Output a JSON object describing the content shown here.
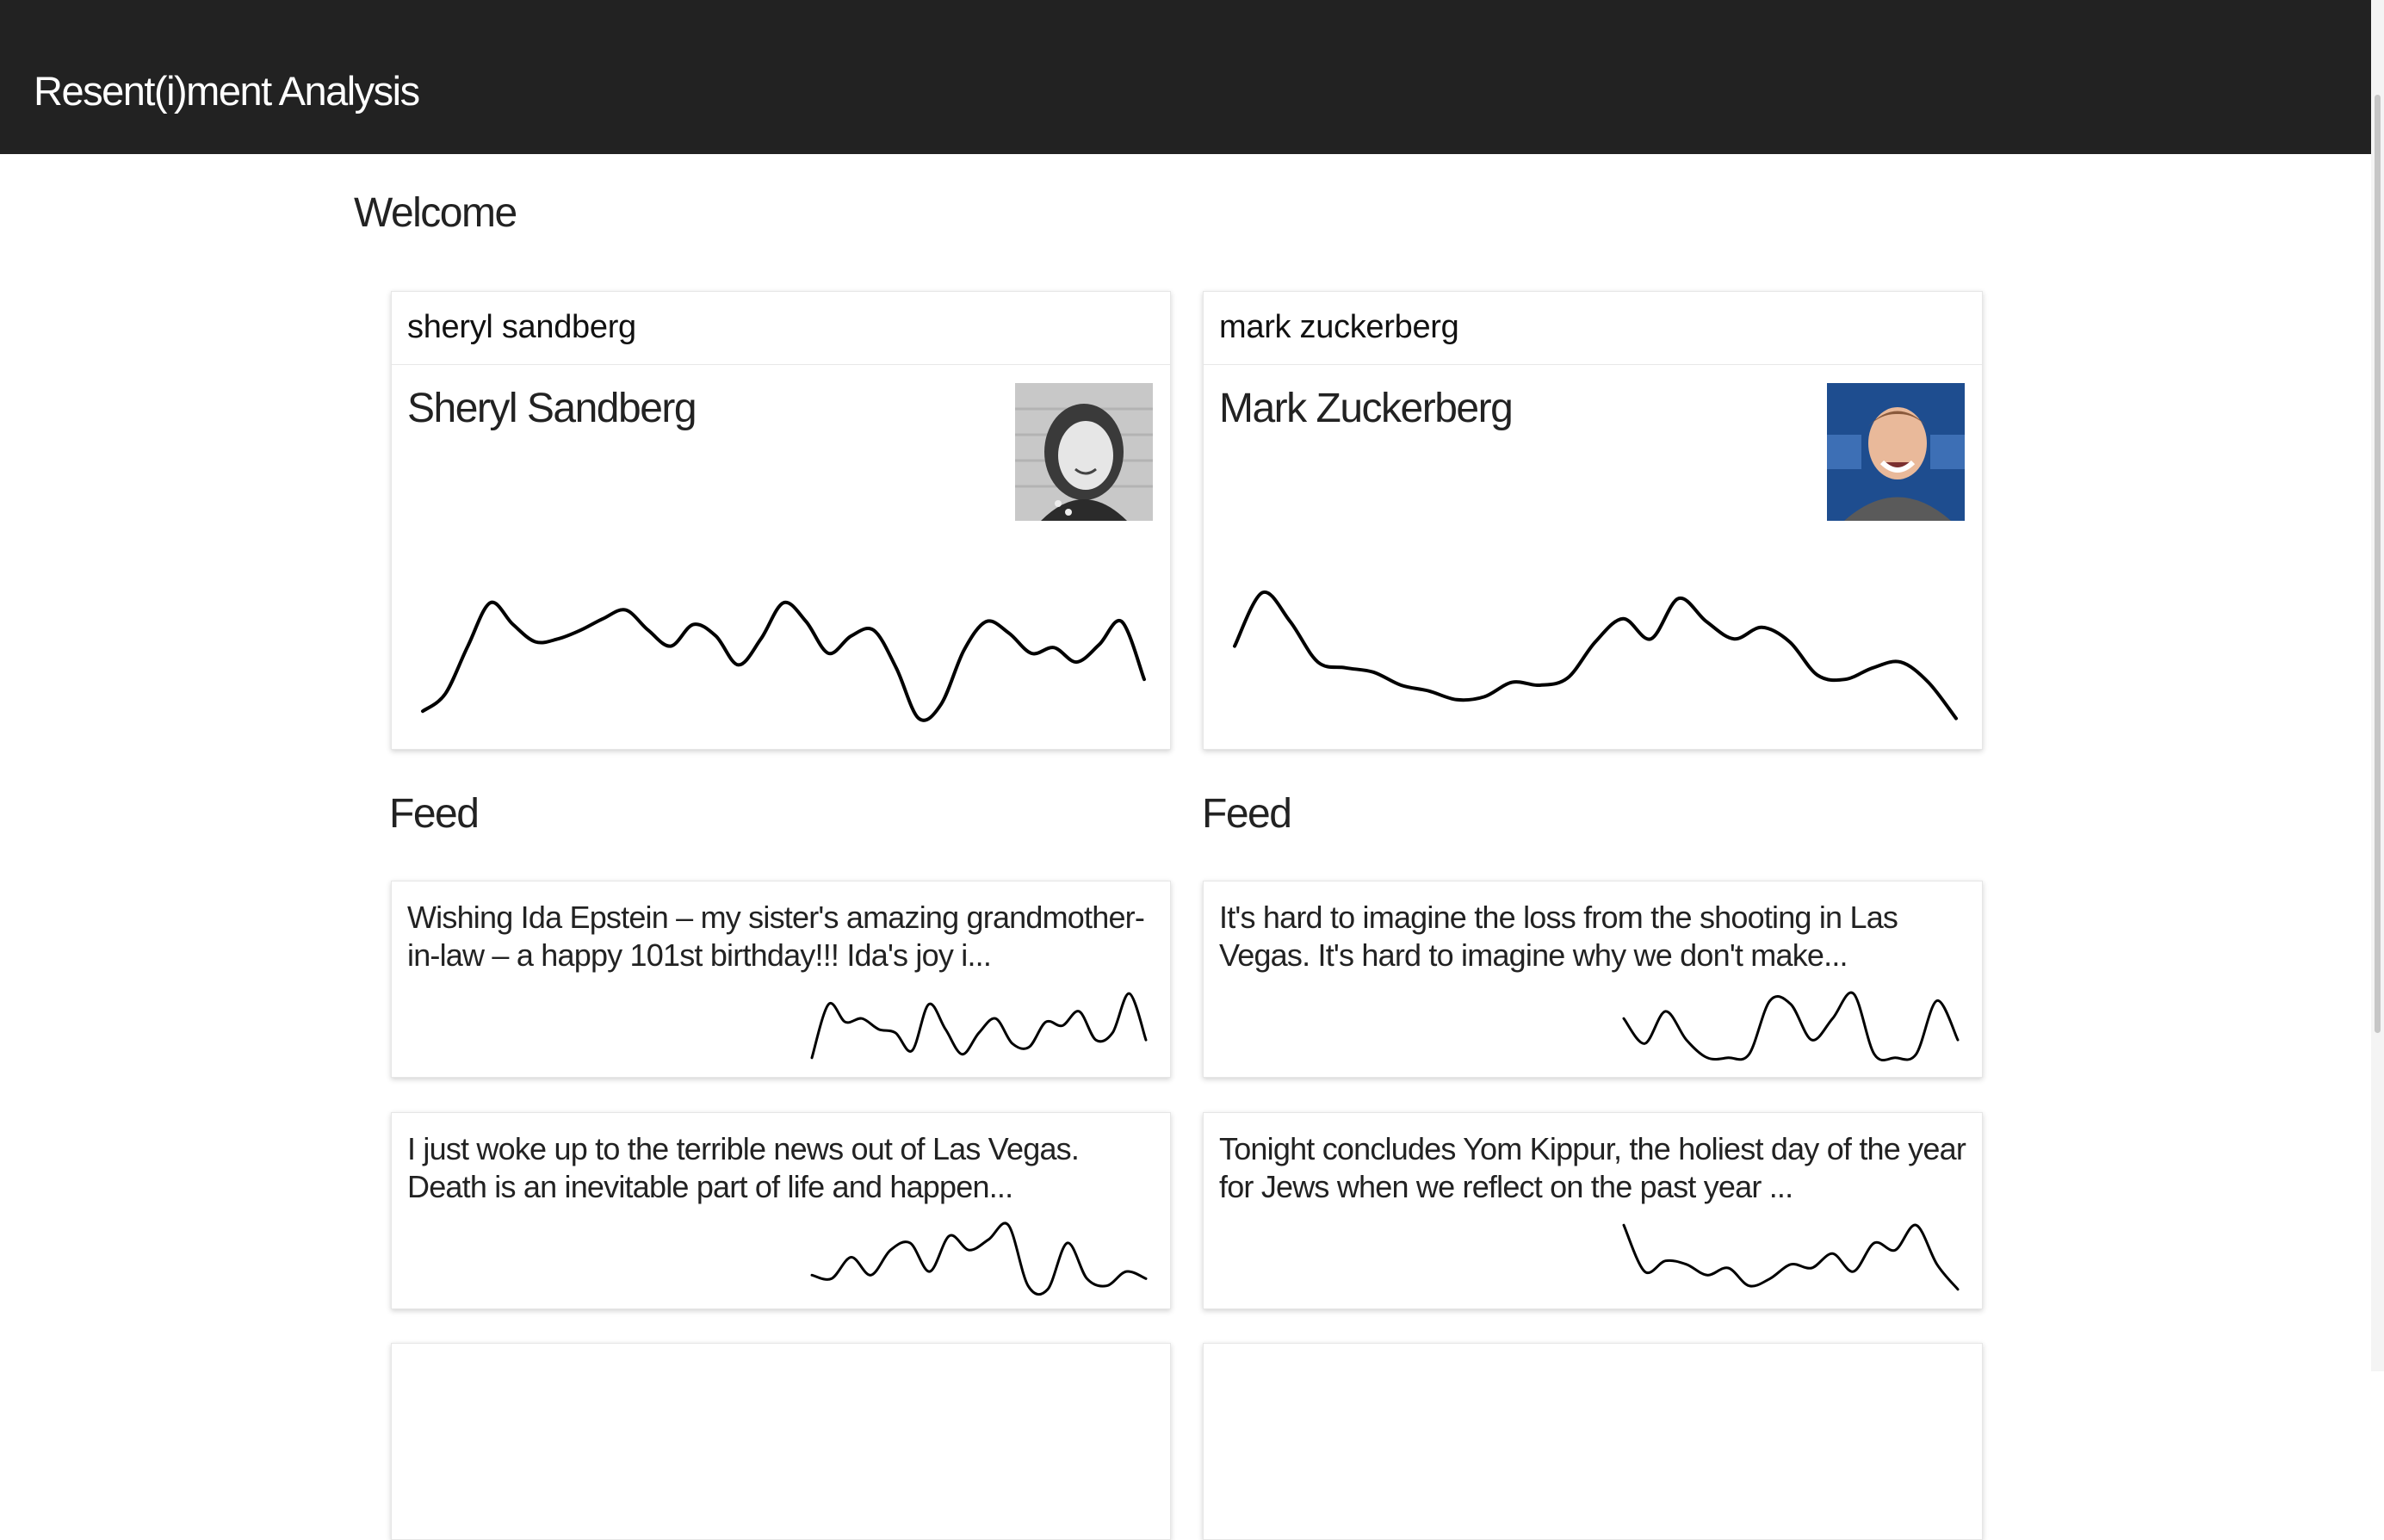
{
  "app": {
    "title": "Resent(i)ment Analysis"
  },
  "page": {
    "heading": "Welcome"
  },
  "profiles": [
    {
      "handle": "sheryl sandberg",
      "name": "Sheryl Sandberg",
      "avatar_icon": "person-photo",
      "sentiment": [
        0.1,
        0.22,
        0.55,
        0.85,
        0.7,
        0.58,
        0.6,
        0.66,
        0.74,
        0.8,
        0.66,
        0.55,
        0.7,
        0.62,
        0.42,
        0.6,
        0.85,
        0.72,
        0.5,
        0.62,
        0.66,
        0.4,
        0.05,
        0.15,
        0.52,
        0.72,
        0.64,
        0.5,
        0.54,
        0.44,
        0.56,
        0.72,
        0.32
      ]
    },
    {
      "handle": "mark zuckerberg",
      "name": "Mark Zuckerberg",
      "avatar_icon": "person-photo",
      "sentiment": [
        0.55,
        0.92,
        0.72,
        0.44,
        0.4,
        0.37,
        0.28,
        0.24,
        0.18,
        0.2,
        0.3,
        0.28,
        0.33,
        0.58,
        0.74,
        0.6,
        0.88,
        0.72,
        0.6,
        0.68,
        0.58,
        0.35,
        0.32,
        0.4,
        0.44,
        0.3,
        0.05
      ]
    }
  ],
  "feeds": [
    {
      "title": "Feed",
      "posts": [
        {
          "text": "Wishing Ida Epstein – my sister's amazing grandmother-in-law – a happy 101st birthday!!! Ida's joy i...",
          "sentiment": [
            0.05,
            0.8,
            0.55,
            0.6,
            0.45,
            0.4,
            0.15,
            0.8,
            0.45,
            0.1,
            0.4,
            0.6,
            0.25,
            0.2,
            0.55,
            0.5,
            0.7,
            0.3,
            0.4,
            0.95,
            0.3
          ]
        },
        {
          "text": "I just woke up to the terrible news out of Las Vegas. Death is an inevitable part of life and happen...",
          "sentiment": [
            0.25,
            0.2,
            0.5,
            0.25,
            0.6,
            0.7,
            0.3,
            0.8,
            0.6,
            0.75,
            0.95,
            0.1,
            0.05,
            0.7,
            0.2,
            0.1,
            0.3,
            0.2
          ]
        }
      ]
    },
    {
      "title": "Feed",
      "posts": [
        {
          "text": "It's hard to imagine the loss from the shooting in Las Vegas. It's hard to imagine why we don't make...",
          "sentiment": [
            0.6,
            0.25,
            0.7,
            0.3,
            0.05,
            0.05,
            0.1,
            0.85,
            0.8,
            0.3,
            0.6,
            0.95,
            0.1,
            0.05,
            0.1,
            0.85,
            0.3
          ]
        },
        {
          "text": "Tonight concludes Yom Kippur, the holiest day of the year for Jews when we reflect on the past year ...",
          "sentiment": [
            0.95,
            0.3,
            0.45,
            0.4,
            0.25,
            0.35,
            0.1,
            0.2,
            0.4,
            0.35,
            0.55,
            0.3,
            0.7,
            0.6,
            0.95,
            0.4,
            0.05
          ]
        }
      ]
    }
  ]
}
